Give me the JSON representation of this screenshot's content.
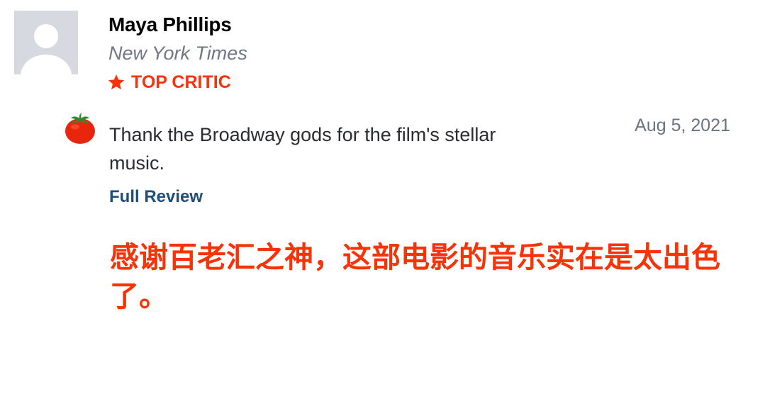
{
  "review": {
    "critic_name": "Maya Phillips",
    "publication": "New York Times",
    "badge": {
      "label": "TOP CRITIC",
      "icon": "star-icon",
      "color": "#f93208"
    },
    "score_icon": "fresh-tomato-icon",
    "quote": "Thank the Broadway gods for the film's stellar music.",
    "date": "Aug 5, 2021",
    "full_review_label": "Full Review"
  },
  "translation": {
    "text": "感谢百老汇之神，这部电影的音乐实在是太出色了。",
    "color": "#f93208"
  },
  "colors": {
    "accent": "#f93208",
    "link": "#1f4e79",
    "muted": "#707784",
    "avatar_bg": "#d6d9df"
  }
}
